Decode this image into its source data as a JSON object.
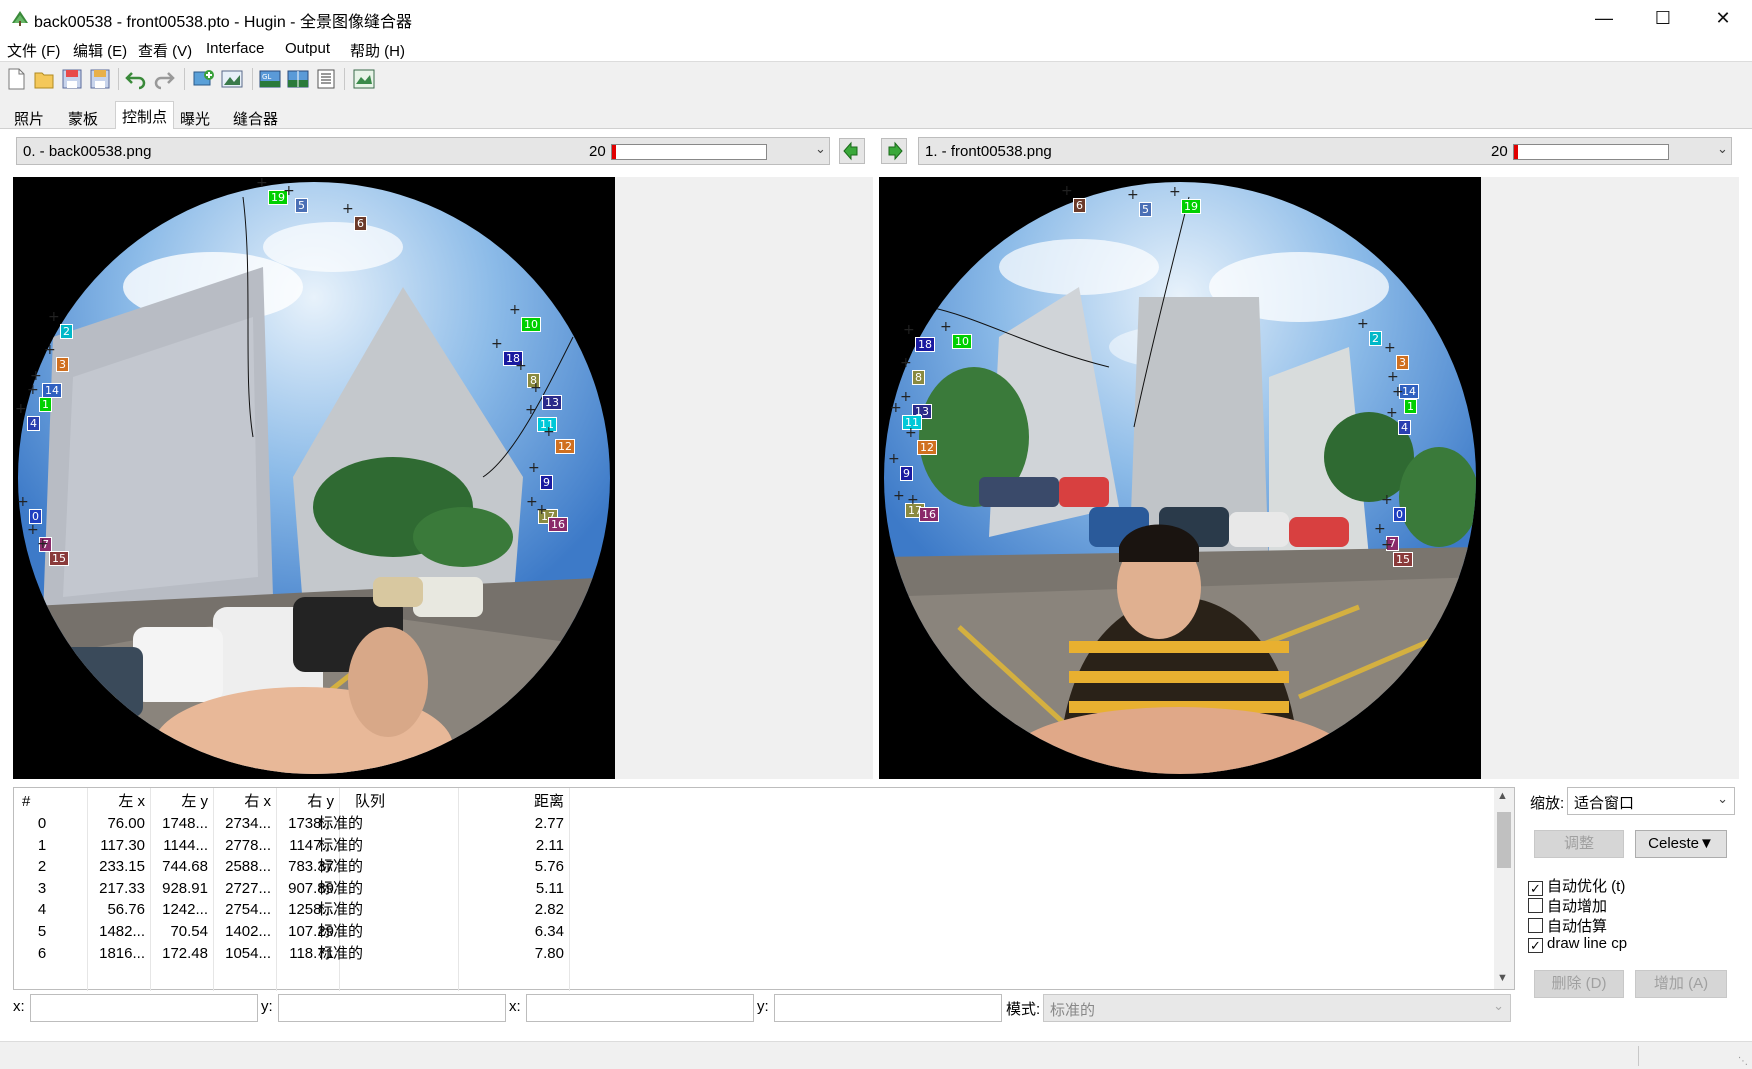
{
  "window": {
    "title": "back00538 - front00538.pto - Hugin - 全景图像缝合器"
  },
  "menu": [
    "文件 (F)",
    "编辑 (E)",
    "查看 (V)",
    "Interface",
    "Output",
    "帮助 (H)"
  ],
  "tabs": [
    "照片",
    "蒙板",
    "控制点",
    "曝光",
    "缝合器"
  ],
  "active_tab": "控制点",
  "left_image": {
    "name": "0. - back00538.png",
    "count": "20"
  },
  "right_image": {
    "name": "1. - front00538.png",
    "count": "20"
  },
  "table": {
    "headers": [
      "#",
      "左 x",
      "左 y",
      "右 x",
      "右 y",
      "队列",
      "距离"
    ],
    "rows": [
      [
        "0",
        "76.00",
        "1748...",
        "2734...",
        "1738...",
        "标准的",
        "2.77"
      ],
      [
        "1",
        "117.30",
        "1144...",
        "2778...",
        "1147...",
        "标准的",
        "2.11"
      ],
      [
        "2",
        "233.15",
        "744.68",
        "2588...",
        "783.37",
        "标准的",
        "5.76"
      ],
      [
        "3",
        "217.33",
        "928.91",
        "2727...",
        "907.89",
        "标准的",
        "5.11"
      ],
      [
        "4",
        "56.76",
        "1242...",
        "2754...",
        "1258...",
        "标准的",
        "2.82"
      ],
      [
        "5",
        "1482...",
        "70.54",
        "1402...",
        "107.29",
        "标准的",
        "6.34"
      ],
      [
        "6",
        "1816...",
        "172.48",
        "1054...",
        "118.71",
        "标准的",
        "7.80"
      ]
    ]
  },
  "controls": {
    "zoom_label": "缩放:",
    "zoom_value": "适合窗口",
    "fine_tune": "调整",
    "detector": "Celeste▼",
    "auto_optimize": "自动优化 (t)",
    "auto_add": "自动增加",
    "auto_estimate": "自动估算",
    "draw_line_cp": "draw line cp",
    "delete": "删除 (D)",
    "add": "增加 (A)"
  },
  "coords": {
    "x1": "x:",
    "y1": "y:",
    "x2": "x:",
    "y2": "y:",
    "mode_label": "模式:",
    "mode_value": "标准的"
  },
  "left_points": [
    {
      "id": "19",
      "color": "#00d000"
    },
    {
      "id": "5",
      "color": "#4a6fb5"
    },
    {
      "id": "6",
      "color": "#6b3a2a"
    },
    {
      "id": "2",
      "color": "#00b8c8"
    },
    {
      "id": "3",
      "color": "#d07020"
    },
    {
      "id": "14",
      "color": "#3060c0"
    },
    {
      "id": "1",
      "color": "#00d000"
    },
    {
      "id": "4",
      "color": "#2a3fb0"
    },
    {
      "id": "10",
      "color": "#00d000"
    },
    {
      "id": "18",
      "color": "#1a1aa0"
    },
    {
      "id": "8",
      "color": "#8a8a40"
    },
    {
      "id": "13",
      "color": "#2a2a8a"
    },
    {
      "id": "11",
      "color": "#00c8d8"
    },
    {
      "id": "12",
      "color": "#d07020"
    },
    {
      "id": "9",
      "color": "#1a1aa0"
    },
    {
      "id": "17",
      "color": "#8a8a40"
    },
    {
      "id": "16",
      "color": "#8a2a6a"
    },
    {
      "id": "0",
      "color": "#2040c0"
    },
    {
      "id": "7",
      "color": "#8a2a6a"
    },
    {
      "id": "15",
      "color": "#8a3a3a"
    }
  ],
  "right_points": [
    {
      "id": "6",
      "color": "#6b3a2a"
    },
    {
      "id": "5",
      "color": "#4a6fb5"
    },
    {
      "id": "19",
      "color": "#00d000"
    },
    {
      "id": "18",
      "color": "#1a1aa0"
    },
    {
      "id": "10",
      "color": "#00d000"
    },
    {
      "id": "8",
      "color": "#8a8a40"
    },
    {
      "id": "13",
      "color": "#2a2a8a"
    },
    {
      "id": "11",
      "color": "#00c8d8"
    },
    {
      "id": "12",
      "color": "#d07020"
    },
    {
      "id": "9",
      "color": "#1a1aa0"
    },
    {
      "id": "17",
      "color": "#8a8a40"
    },
    {
      "id": "16",
      "color": "#8a2a6a"
    },
    {
      "id": "2",
      "color": "#00b8c8"
    },
    {
      "id": "3",
      "color": "#d07020"
    },
    {
      "id": "14",
      "color": "#3060c0"
    },
    {
      "id": "1",
      "color": "#00d000"
    },
    {
      "id": "4",
      "color": "#2a3fb0"
    },
    {
      "id": "0",
      "color": "#2040c0"
    },
    {
      "id": "7",
      "color": "#8a2a6a"
    },
    {
      "id": "15",
      "color": "#8a3a3a"
    }
  ]
}
